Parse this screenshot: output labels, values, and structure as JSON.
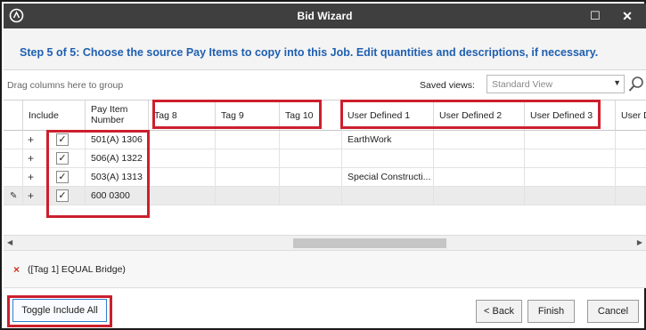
{
  "window": {
    "title": "Bid Wizard",
    "maximize_glyph": "☐",
    "close_glyph": "✕"
  },
  "step": {
    "text": "Step 5 of 5: Choose the source Pay Items to copy into this Job. Edit quantities and descriptions, if necessary."
  },
  "group_panel": {
    "hint": "Drag columns here to group",
    "saved_views_label": "Saved views:",
    "saved_views_value": "Standard View"
  },
  "grid": {
    "columns": {
      "include": "Include",
      "pay_item_line1": "Pay Item",
      "pay_item_line2": "Number",
      "tag8": "Tag 8",
      "tag9": "Tag 9",
      "tag10": "Tag 10",
      "ud1": "User Defined 1",
      "ud2": "User Defined 2",
      "ud3": "User Defined 3",
      "ud4": "User D"
    },
    "rows": [
      {
        "expand": "+",
        "checked": "✓",
        "pay_item": "501(A) 1306",
        "ud1": "EarthWork"
      },
      {
        "expand": "+",
        "checked": "✓",
        "pay_item": "506(A) 1322",
        "ud1": ""
      },
      {
        "expand": "+",
        "checked": "✓",
        "pay_item": "503(A) 1313",
        "ud1": "Special Constructi..."
      },
      {
        "expand": "+",
        "checked": "✓",
        "pay_item": "600 0300",
        "ud1": ""
      }
    ],
    "active_row_glyph": "✎"
  },
  "filter": {
    "clear_glyph": "×",
    "expression": "([Tag 1] EQUAL Bridge)"
  },
  "buttons": {
    "toggle_include_all": "Toggle Include All",
    "back": "< Back",
    "finish": "Finish",
    "cancel": "Cancel"
  },
  "colors": {
    "title_bar": "#3f3f3f",
    "step_text": "#1f5fb0",
    "callout": "#cc1f2d",
    "filter_x": "#d0321e"
  }
}
